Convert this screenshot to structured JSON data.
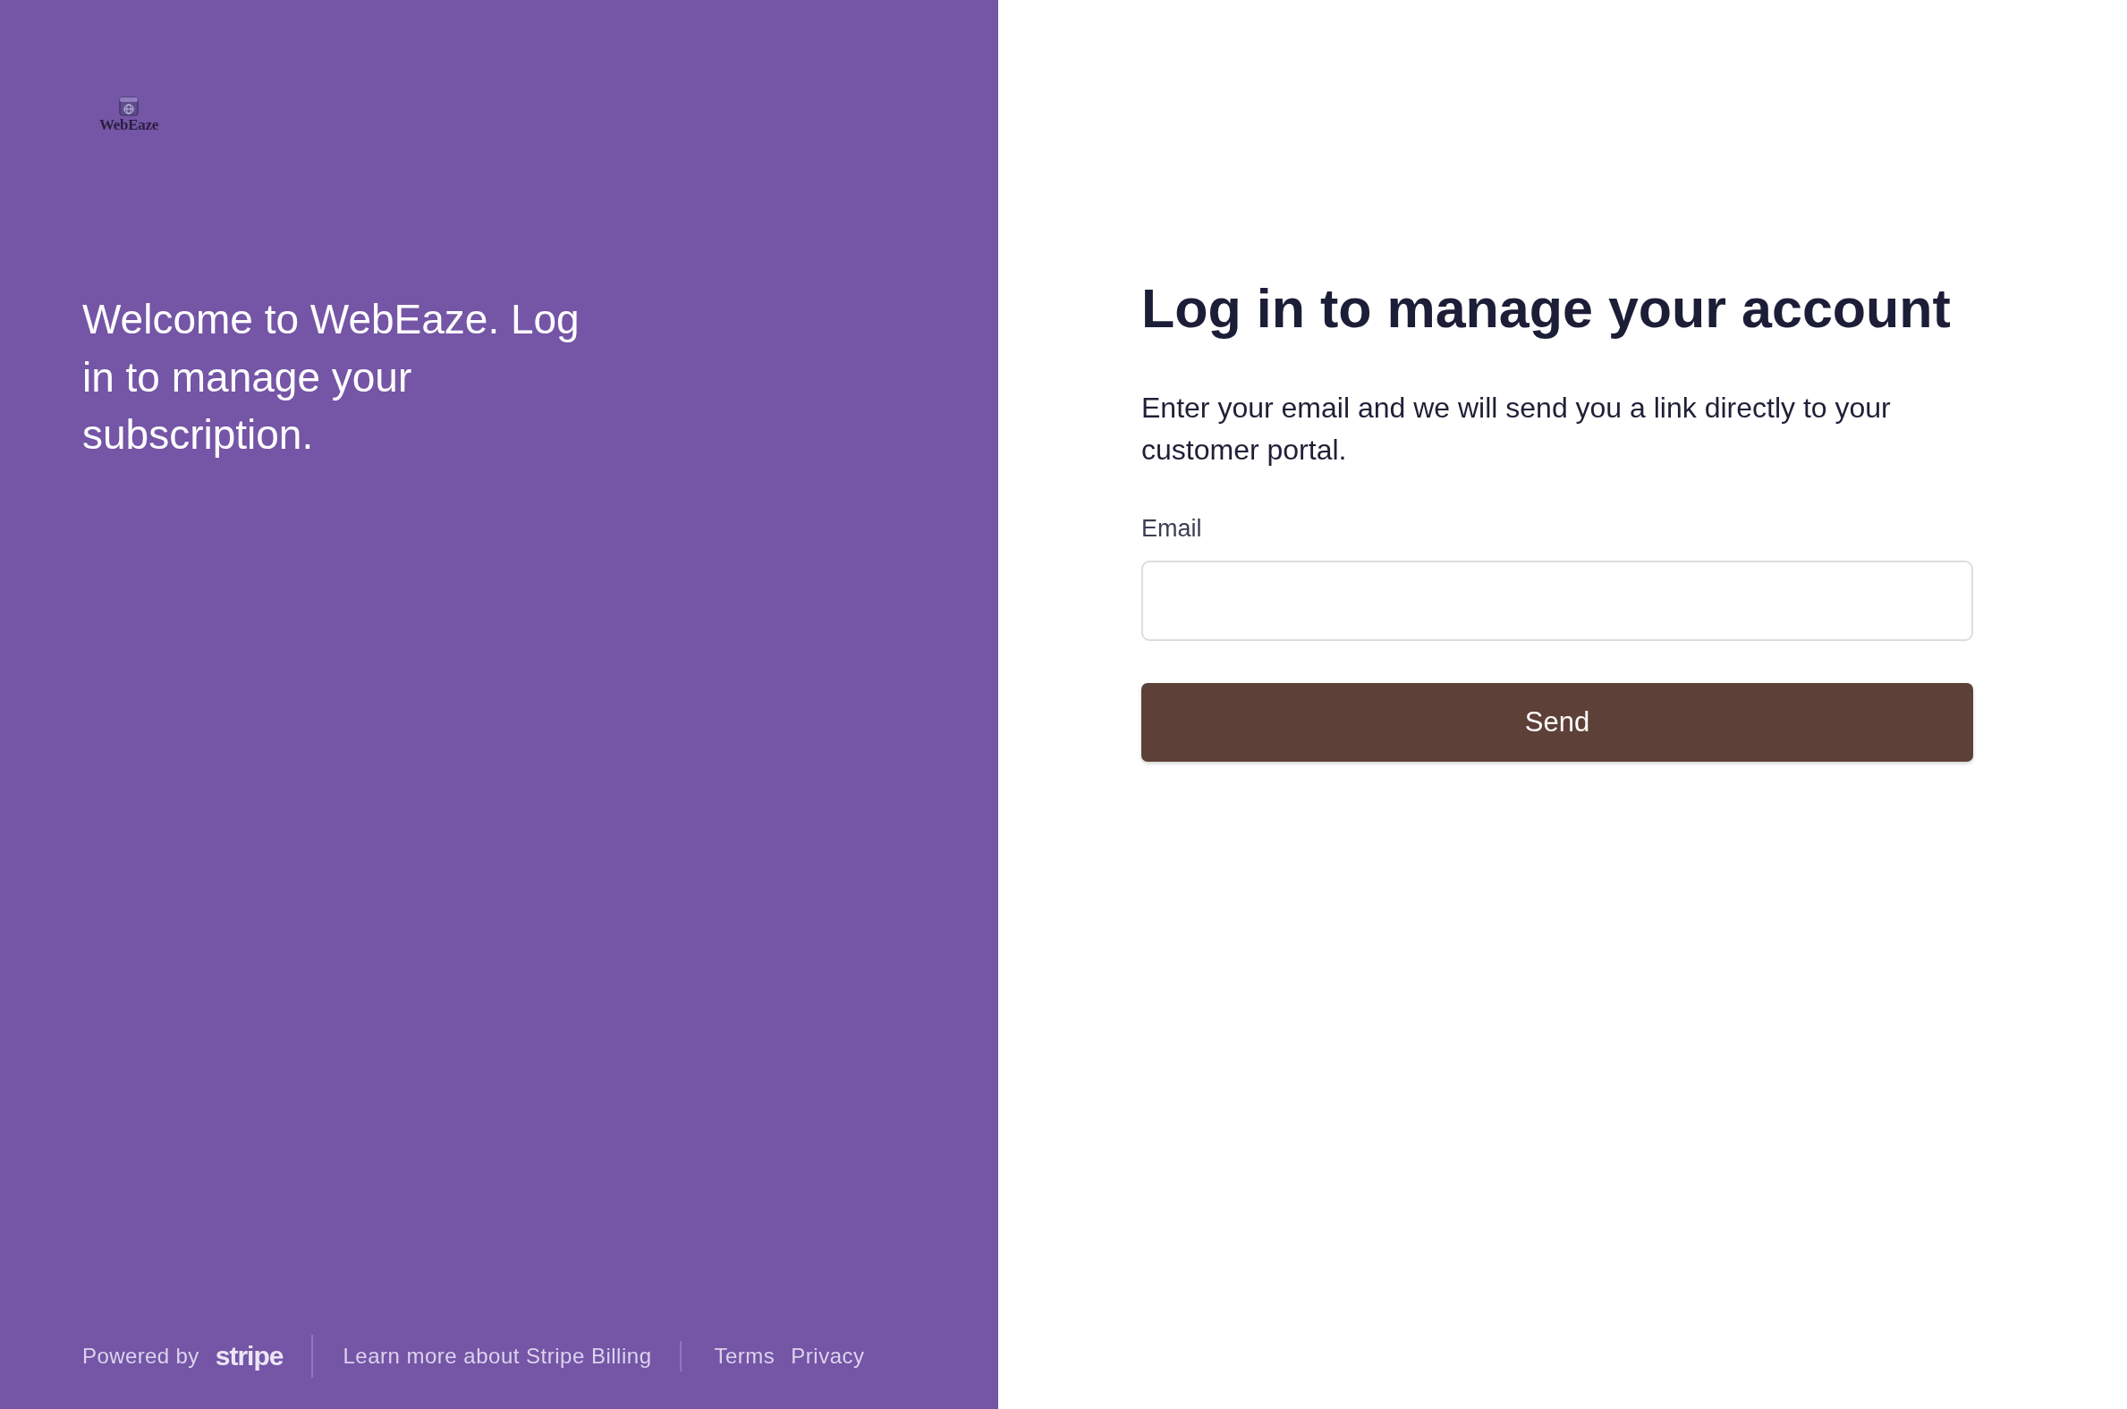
{
  "brand": {
    "name": "WebEaze"
  },
  "welcome": {
    "text": "Welcome to WebEaze. Log in to manage your subscription."
  },
  "form": {
    "title": "Log in to manage your account",
    "description": "Enter your email and we will send you a link directly to your customer portal.",
    "email": {
      "label": "Email"
    },
    "submit": "Send"
  },
  "footer": {
    "powered_by": "Powered by",
    "wordmark": "stripe",
    "link_groups": [
      [
        "Learn more about Stripe Billing"
      ],
      [
        "Terms",
        "Privacy"
      ]
    ]
  }
}
